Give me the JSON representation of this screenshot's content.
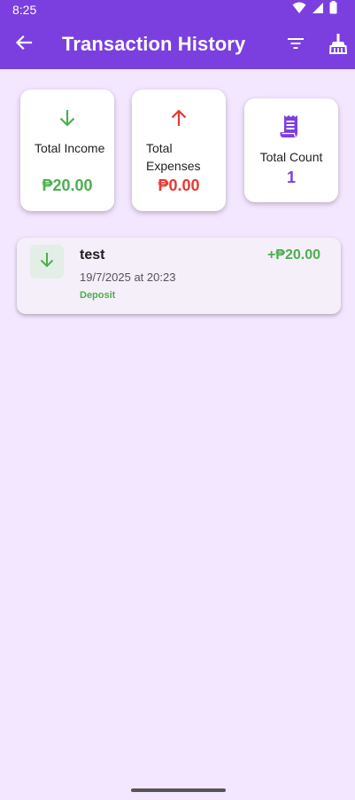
{
  "status_bar": {
    "time": "8:25",
    "icons": [
      "wifi-icon",
      "cellular-signal-icon",
      "battery-icon"
    ]
  },
  "app_bar": {
    "title": "Transaction History",
    "back_icon": "arrow-left-icon",
    "actions": [
      "filter-icon",
      "broom-icon"
    ]
  },
  "summary": {
    "income": {
      "label": "Total Income",
      "value": "₱20.00",
      "icon": "arrow-down-icon",
      "color": "#4caf50"
    },
    "expenses": {
      "label": "Total Expenses",
      "value": "₱0.00",
      "icon": "arrow-up-icon",
      "color": "#e53935"
    },
    "count": {
      "label": "Total Count",
      "value": "1",
      "icon": "receipt-icon",
      "color": "#7b3fe0"
    }
  },
  "transactions": [
    {
      "name": "test",
      "amount": "+₱20.00",
      "datetime": "19/7/2025 at 20:23",
      "type": "Deposit",
      "icon": "arrow-down-icon",
      "color": "#4caf50"
    }
  ],
  "colors": {
    "primary": "#7b3fe0",
    "background": "#f3e6ff",
    "income": "#4caf50",
    "expense": "#e53935"
  }
}
